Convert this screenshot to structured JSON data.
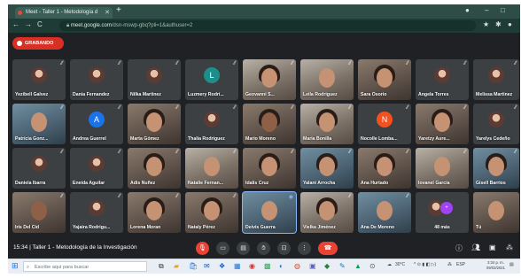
{
  "browser": {
    "tab_title": "Meet - Taller 1 - Metodología d",
    "url_host": "meet.google.com",
    "url_path": "/dsn-mswp-gbq?pli=1&authuser=2"
  },
  "meet": {
    "recording_label": "GRABANDO",
    "participants": [
      {
        "name": "Yezibell Galvez"
      },
      {
        "name": "Dania Fernandez"
      },
      {
        "name": "Nilka Martinez"
      },
      {
        "name": "Luzmery Rodrí..."
      },
      {
        "name": "Geovanni S..."
      },
      {
        "name": "Leila Rodriguez"
      },
      {
        "name": "Sara Osorio"
      },
      {
        "name": "Angela Torres"
      },
      {
        "name": "Melissa Martinez"
      },
      {
        "name": "Patricia Gonz..."
      },
      {
        "name": "Andrea Guerrel"
      },
      {
        "name": "Marta Gómez"
      },
      {
        "name": "Thalia Rodriguez"
      },
      {
        "name": "Mario Moreno"
      },
      {
        "name": "Maria Bonilla"
      },
      {
        "name": "Nocolle Lomba..."
      },
      {
        "name": "Yaretzy Aure..."
      },
      {
        "name": "Yarelys Cedeño"
      },
      {
        "name": "Daniela Ibarra"
      },
      {
        "name": "Eneida Aguilar"
      },
      {
        "name": "Adis Nuñez"
      },
      {
        "name": "Natalie Fernan..."
      },
      {
        "name": "Idalis Cruz"
      },
      {
        "name": "Yalani Arrocha"
      },
      {
        "name": "Ana Hurtado"
      },
      {
        "name": "Iovanel García"
      },
      {
        "name": "Gisell Barrios"
      },
      {
        "name": "Iris Del Cid"
      },
      {
        "name": "Yajaira Rodrigu..."
      },
      {
        "name": "Lorena Moran"
      },
      {
        "name": "Nataly Pérez"
      },
      {
        "name": "Deivis Guerra"
      },
      {
        "name": "Vielka Jiménez"
      },
      {
        "name": "Ana De Moreno"
      },
      {
        "name": "48 más"
      },
      {
        "name": "Tú"
      }
    ],
    "time": "15:34",
    "meeting_title": "Taller 1 - Metodología de la Investigación"
  },
  "taskbar": {
    "search_placeholder": "Escribe aquí para buscar",
    "temperature": "30°C",
    "language": "ESP",
    "clock_time": "3:34 p. m.",
    "clock_date": "09/03/2021"
  }
}
